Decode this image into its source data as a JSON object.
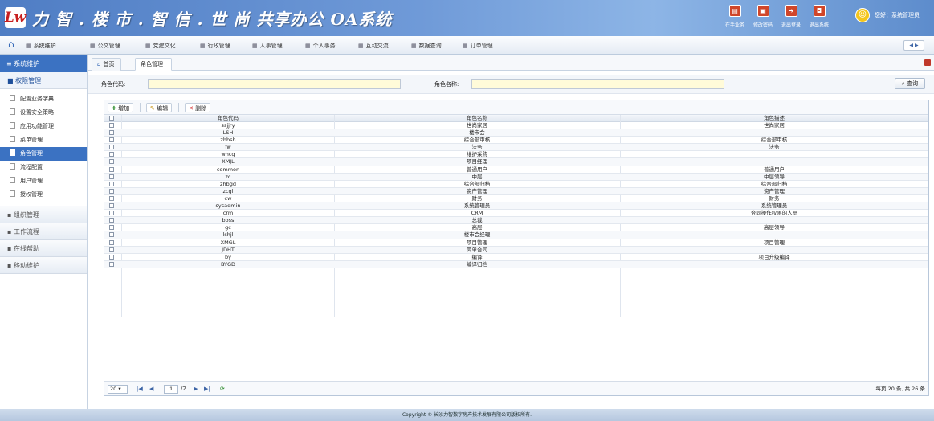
{
  "header": {
    "logo_mark": "Lw",
    "title": "力 智 . 楼 市 . 智 信 . 世 尚 共享办公 OA系统",
    "buttons": [
      {
        "label": "在手业务",
        "icon": "briefcase-icon"
      },
      {
        "label": "修改密码",
        "icon": "lock-icon"
      },
      {
        "label": "退出登录",
        "icon": "logout-icon"
      },
      {
        "label": "退出系统",
        "icon": "power-icon"
      }
    ],
    "user_greeting": "您好：系统管理员"
  },
  "menubar": {
    "items": [
      "系统维护",
      "公文管理",
      "党建文化",
      "行政管理",
      "人事管理",
      "个人事务",
      "互动交流",
      "数据查询",
      "订单管理"
    ],
    "nav_arrows": "◀ ▶"
  },
  "sidebar": {
    "header": "系统维护",
    "active_section": "权限管理",
    "items": [
      "配置业务字典",
      "设置安全策略",
      "应用功能管理",
      "菜单管理",
      "角色管理",
      "流程配置",
      "用户管理",
      "授权管理"
    ],
    "active_item_index": 4,
    "sections": [
      "组织管理",
      "工作流程",
      "在线帮助",
      "移动维护"
    ]
  },
  "tabs": {
    "home": "首页",
    "current": "角色管理"
  },
  "search": {
    "code_label": "角色代码:",
    "name_label": "角色名称:",
    "code_value": "",
    "name_value": "",
    "button": "查询"
  },
  "toolbar": {
    "add": "增加",
    "edit": "编辑",
    "delete": "删除"
  },
  "table": {
    "columns": [
      "角色代码",
      "角色名称",
      "角色描述"
    ],
    "rows": [
      [
        "ssjjry",
        "世尚家居",
        "世尚家居"
      ],
      [
        "LSH",
        "楼市会",
        ""
      ],
      [
        "zhbsh",
        "综合部审核",
        "综合部审核"
      ],
      [
        "fw",
        "法务",
        "法务"
      ],
      [
        "whcg",
        "维护采购",
        ""
      ],
      [
        "XMJL",
        "项目经理",
        ""
      ],
      [
        "common",
        "普通用户",
        "普通用户"
      ],
      [
        "zc",
        "中层",
        "中层领导"
      ],
      [
        "zhbgd",
        "综合部归档",
        "综合部归档"
      ],
      [
        "zcgl",
        "资产管理",
        "资产管理"
      ],
      [
        "cw",
        "财务",
        "财务"
      ],
      [
        "sysadmin",
        "系统管理员",
        "系统管理员"
      ],
      [
        "crm",
        "CRM",
        "合同操作权限的人员"
      ],
      [
        "boss",
        "总裁",
        ""
      ],
      [
        "gc",
        "高层",
        "高层领导"
      ],
      [
        "lshjl",
        "楼市会经理",
        ""
      ],
      [
        "XMGL",
        "项目管理",
        "项目管理"
      ],
      [
        "JDHT",
        "简单合同",
        ""
      ],
      [
        "by",
        "编译",
        "项目升级编译"
      ],
      [
        "BYGD",
        "编译归档",
        ""
      ]
    ]
  },
  "pager": {
    "page_size": "20",
    "page_input": "1",
    "total_pages": "/2",
    "info": "每页 20 条, 共 26 条"
  },
  "footer": "Copyright © 长沙力智数字房产技术发展有限公司版权所有."
}
